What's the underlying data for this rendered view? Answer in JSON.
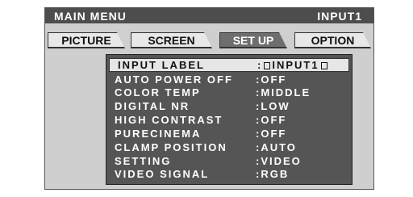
{
  "header": {
    "title": "MAIN MENU",
    "input": "INPUT1"
  },
  "tabs": [
    {
      "label": "PICTURE",
      "active": false
    },
    {
      "label": "SCREEN",
      "active": false
    },
    {
      "label": "SET UP",
      "active": true
    },
    {
      "label": "OPTION",
      "active": false
    }
  ],
  "menu": {
    "items": [
      {
        "label": "INPUT LABEL",
        "value": ":",
        "value_text": "INPUT1",
        "selected": true
      },
      {
        "label": "AUTO POWER OFF",
        "value": ":OFF"
      },
      {
        "label": "COLOR TEMP",
        "value": ":MIDDLE"
      },
      {
        "label": "DIGITAL NR",
        "value": ":LOW"
      },
      {
        "label": "HIGH CONTRAST",
        "value": ":OFF"
      },
      {
        "label": "PURECINEMA",
        "value": ":OFF"
      },
      {
        "label": "CLAMP POSITION",
        "value": ":AUTO"
      },
      {
        "label": "SETTING",
        "value": ":VIDEO"
      },
      {
        "label": "VIDEO SIGNAL",
        "value": ":RGB"
      }
    ]
  },
  "colors": {
    "panel_bg": "#cfcfcf",
    "title_bar_bg": "#4d4d4d",
    "menu_bg": "#555555",
    "active_tab_bg": "#6e6e6e",
    "selected_row_bg": "#e6e6e6"
  }
}
